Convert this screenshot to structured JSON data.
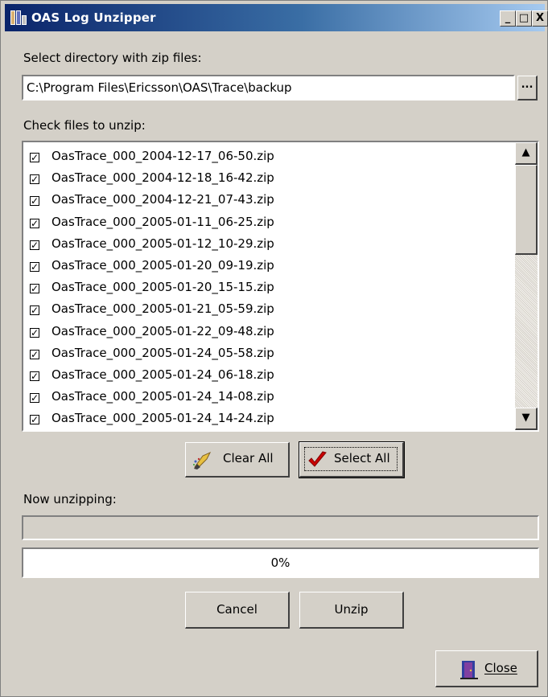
{
  "window": {
    "title": "OAS Log Unzipper",
    "controls": {
      "minimize": "_",
      "maximize": "□",
      "close": "X"
    }
  },
  "directory": {
    "label": "Select directory with zip files:",
    "value": "C:\\Program Files\\Ericsson\\OAS\\Trace\\backup",
    "browse_label": "..."
  },
  "files": {
    "label": "Check files to unzip:",
    "items": [
      {
        "name": "OasTrace_000_2004-12-17_06-50.zip",
        "checked": true
      },
      {
        "name": "OasTrace_000_2004-12-18_16-42.zip",
        "checked": true
      },
      {
        "name": "OasTrace_000_2004-12-21_07-43.zip",
        "checked": true
      },
      {
        "name": "OasTrace_000_2005-01-11_06-25.zip",
        "checked": true
      },
      {
        "name": "OasTrace_000_2005-01-12_10-29.zip",
        "checked": true
      },
      {
        "name": "OasTrace_000_2005-01-20_09-19.zip",
        "checked": true
      },
      {
        "name": "OasTrace_000_2005-01-20_15-15.zip",
        "checked": true
      },
      {
        "name": "OasTrace_000_2005-01-21_05-59.zip",
        "checked": true
      },
      {
        "name": "OasTrace_000_2005-01-22_09-48.zip",
        "checked": true
      },
      {
        "name": "OasTrace_000_2005-01-24_05-58.zip",
        "checked": true
      },
      {
        "name": "OasTrace_000_2005-01-24_06-18.zip",
        "checked": true
      },
      {
        "name": "OasTrace_000_2005-01-24_14-08.zip",
        "checked": true
      },
      {
        "name": "OasTrace_000_2005-01-24_14-24.zip",
        "checked": true
      }
    ]
  },
  "buttons": {
    "clear_all": "Clear All",
    "select_all": "Select All",
    "cancel": "Cancel",
    "unzip": "Unzip",
    "close": "Close"
  },
  "progress": {
    "label": "Now unzipping:",
    "current_file": "",
    "percent_text": "0%",
    "percent": 0
  },
  "colors": {
    "titlebar_start": "#0a246a",
    "titlebar_end": "#a6caf0",
    "dialog_face": "#d4d0c8",
    "check_red": "#cc0000"
  }
}
